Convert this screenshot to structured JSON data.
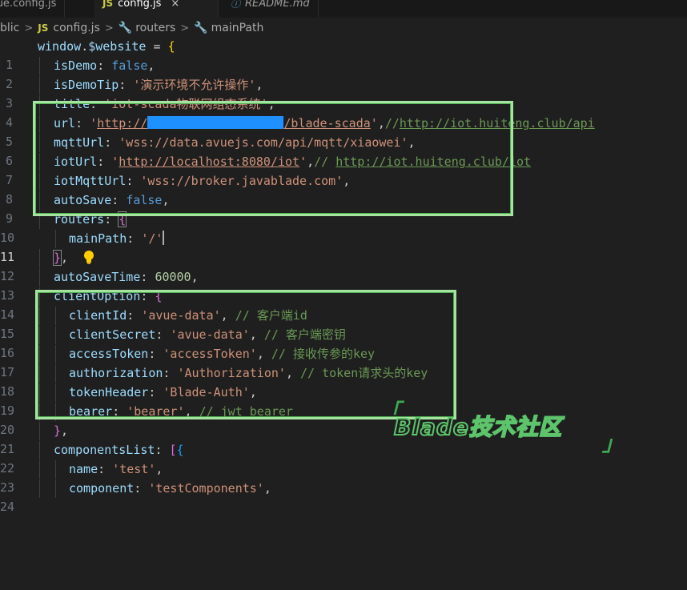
{
  "tabs": [
    {
      "label": "vue.config.js",
      "active": false,
      "icon": "js-icon"
    },
    {
      "label": "config.js",
      "active": true,
      "icon": "js-icon",
      "close": "×"
    },
    {
      "label": "README.md",
      "active": false,
      "icon": "info-icon"
    }
  ],
  "breadcrumb": {
    "items": [
      "blic",
      "config.js",
      "routers",
      "mainPath"
    ],
    "js_badge": "JS"
  },
  "colors": {
    "variable": "#9cdcfe",
    "keyword": "#569cd6",
    "string": "#ce9178",
    "number": "#b5cea8",
    "comment": "#6a9955",
    "highlight_box": "#a6e3a0",
    "redaction": "#1e90ff",
    "watermark": "#4caf50"
  },
  "code": {
    "l1": {
      "n": "1",
      "a": "window",
      "b": ".",
      "c": "$website",
      "d": " = ",
      "e": "{"
    },
    "l2": {
      "n": "2",
      "key": "isDemo",
      "colon": ": ",
      "val": "false",
      "tail": ","
    },
    "l3": {
      "n": "3",
      "key": "isDemoTip",
      "colon": ": ",
      "val": "'演示环境不允许操作'",
      "tail": ","
    },
    "l4": {
      "n": "4",
      "key": "title",
      "colon": ": ",
      "val": "'iot-scada物联网组态系统'",
      "tail": ","
    },
    "l5": {
      "n": "5",
      "key": "url",
      "colon": ": ",
      "q": "'",
      "url1": "http://",
      "url2": "/blade-scada",
      "q2": "'",
      "tail": ",",
      "cmt1": "//",
      "cmt2": "http://iot.huiteng.club/api"
    },
    "l6": {
      "n": "6",
      "key": "mqttUrl",
      "colon": ": ",
      "val": "'wss://data.avuejs.com/api/mqtt/xiaowei'",
      "tail": ","
    },
    "l7": {
      "n": "7",
      "key": "iotUrl",
      "colon": ": ",
      "q": "'",
      "url": "http://localhost:8080/iot",
      "q2": "'",
      "tail": ",",
      "cmt1": "// ",
      "cmt2": "http://iot.huiteng.club/iot"
    },
    "l8": {
      "n": "8",
      "key": "iotMqttUrl",
      "colon": ": ",
      "val": "'wss://broker.javablade.com'",
      "tail": ","
    },
    "l9": {
      "n": "9",
      "key": "autoSave",
      "colon": ": ",
      "val": "false",
      "tail": ","
    },
    "l10": {
      "n": "10",
      "key": "routers",
      "colon": ": ",
      "open": "{"
    },
    "l11": {
      "n": "11",
      "key": "mainPath",
      "colon": ": ",
      "val": "'/'"
    },
    "l12": {
      "n": "12",
      "close": "}",
      "tail": ","
    },
    "l13": {
      "n": "13",
      "key": "autoSaveTime",
      "colon": ": ",
      "val": "60000",
      "tail": ","
    },
    "l14": {
      "n": "14",
      "key": "clientOption",
      "colon": ": ",
      "open": "{"
    },
    "l15": {
      "n": "15",
      "key": "clientId",
      "colon": ": ",
      "val": "'avue-data'",
      "tail": ", ",
      "cmt": "// 客户端id"
    },
    "l16": {
      "n": "16",
      "key": "clientSecret",
      "colon": ": ",
      "val": "'avue-data'",
      "tail": ", ",
      "cmt": "// 客户端密钥"
    },
    "l17": {
      "n": "17",
      "key": "accessToken",
      "colon": ": ",
      "val": "'accessToken'",
      "tail": ", ",
      "cmt": "// 接收传参的key"
    },
    "l18": {
      "n": "18",
      "key": "authorization",
      "colon": ": ",
      "val": "'Authorization'",
      "tail": ", ",
      "cmt": "// token请求头的key"
    },
    "l19": {
      "n": "19",
      "key": "tokenHeader",
      "colon": ": ",
      "val": "'Blade-Auth'",
      "tail": ","
    },
    "l20": {
      "n": "20",
      "key": "bearer",
      "colon": ": ",
      "val": "'bearer'",
      "tail": ", ",
      "cmt": "// jwt bearer"
    },
    "l21": {
      "n": "21",
      "close": "}",
      "tail": ","
    },
    "l22": {
      "n": "22",
      "key": "componentsList",
      "colon": ": ",
      "open1": "[",
      "open2": "{"
    },
    "l23": {
      "n": "23",
      "key": "name",
      "colon": ": ",
      "val": "'test'",
      "tail": ","
    },
    "l24": {
      "n": "24",
      "key": "component",
      "colon": ": ",
      "val": "'testComponents'",
      "tail": ","
    }
  },
  "watermark": {
    "text": "Blade技术社区",
    "open": "「",
    "close": "」"
  }
}
